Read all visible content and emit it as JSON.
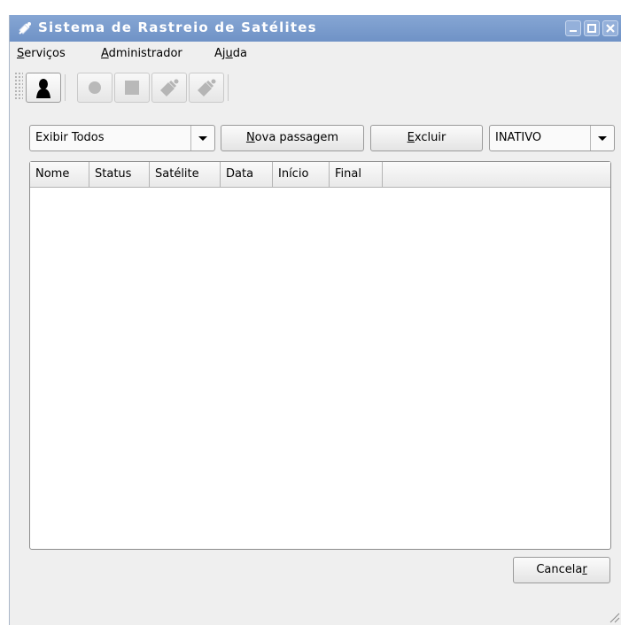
{
  "window": {
    "title": "Sistema de Rastreio de Satélites"
  },
  "menu": {
    "items": [
      {
        "label": "Serviços",
        "mnemonic": "S"
      },
      {
        "label": "Administrador",
        "mnemonic": "A"
      },
      {
        "label": "Ajuda",
        "mnemonic": "u"
      }
    ]
  },
  "toolbar": {
    "buttons": [
      {
        "icon": "person-icon"
      },
      {
        "icon": "record-icon"
      },
      {
        "icon": "stop-icon"
      },
      {
        "icon": "satellite-dish-icon"
      },
      {
        "icon": "satellite-dish-icon"
      }
    ]
  },
  "filter": {
    "selected": "Exibir Todos"
  },
  "actions": {
    "new_pass_pre": "",
    "new_pass_key": "N",
    "new_pass_post": "ova passagem",
    "delete_pre": "",
    "delete_key": "E",
    "delete_post": "xcluir"
  },
  "status_select": {
    "selected": "INATIVO"
  },
  "table": {
    "columns": [
      "Nome",
      "Status",
      "Satélite",
      "Data",
      "Início",
      "Final"
    ],
    "rows": []
  },
  "footer": {
    "cancel_pre": "Cancela",
    "cancel_key": "r",
    "cancel_post": ""
  },
  "colors": {
    "titlebar": "#7a9bcf",
    "window_bg": "#efefef"
  }
}
